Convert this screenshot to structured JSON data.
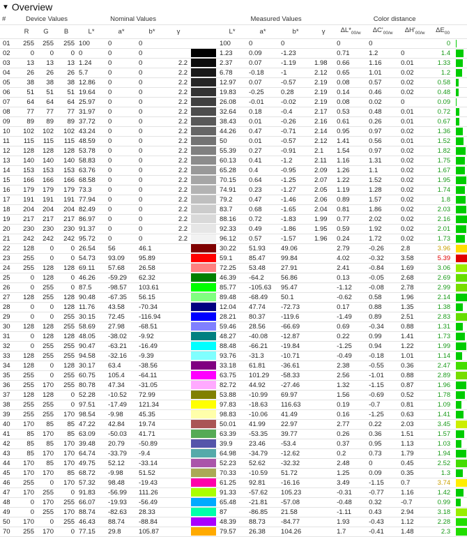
{
  "section": {
    "title": "Overview",
    "collapse_icon": "triangle-down-icon"
  },
  "header": {
    "group_row": [
      "#",
      "Device Values",
      "Nominal Values",
      "Measured Values",
      "Color distance"
    ],
    "columns": [
      "R",
      "G",
      "B",
      "L*",
      "a*",
      "b*",
      "γ",
      "L*",
      "a*",
      "b*",
      "γ",
      "ΔL*00/w",
      "ΔC'00/w",
      "ΔH'00/w",
      "ΔE00"
    ]
  },
  "colors": {
    "good": "#1a9a1a",
    "warn": "#c9a000",
    "bad": "#e00000"
  },
  "rows": [
    {
      "n": "01",
      "r": "255",
      "g": "255",
      "b": "255",
      "nl": "100",
      "na": "0",
      "nb": "0",
      "ng": "",
      "ml": "100",
      "ma": "0",
      "mb": "0",
      "mg": "",
      "dl": "0",
      "dc": "0",
      "dh": "",
      "de": "0",
      "sw": "#ffffff",
      "barc": "#00cc00"
    },
    {
      "n": "02",
      "r": "0",
      "g": "0",
      "b": "0",
      "nl": "0",
      "na": "0",
      "nb": "0",
      "ng": "",
      "ml": "1.23",
      "ma": "0.09",
      "mb": "-1.23",
      "mg": "",
      "dl": "0.71",
      "dc": "1.2",
      "dh": "0",
      "de": "1.4",
      "sw": "#000000",
      "barc": "#00cc00"
    },
    {
      "n": "03",
      "r": "13",
      "g": "13",
      "b": "13",
      "nl": "1.24",
      "na": "0",
      "nb": "0",
      "ng": "2.2",
      "ml": "2.37",
      "ma": "0.07",
      "mb": "-1.19",
      "mg": "1.98",
      "dl": "0.66",
      "dc": "1.16",
      "dh": "0.01",
      "de": "1.33",
      "sw": "#0d0d0d",
      "barc": "#00cc00"
    },
    {
      "n": "04",
      "r": "26",
      "g": "26",
      "b": "26",
      "nl": "5.7",
      "na": "0",
      "nb": "0",
      "ng": "2.2",
      "ml": "6.78",
      "ma": "-0.18",
      "mb": "-1",
      "mg": "2.12",
      "dl": "0.65",
      "dc": "1.01",
      "dh": "0.02",
      "de": "1.2",
      "sw": "#1a1a1a",
      "barc": "#00cc00"
    },
    {
      "n": "05",
      "r": "38",
      "g": "38",
      "b": "38",
      "nl": "12.86",
      "na": "0",
      "nb": "0",
      "ng": "2.2",
      "ml": "12.97",
      "ma": "0.07",
      "mb": "-0.57",
      "mg": "2.19",
      "dl": "0.08",
      "dc": "0.57",
      "dh": "0.02",
      "de": "0.58",
      "sw": "#262626",
      "barc": "#00cc00"
    },
    {
      "n": "06",
      "r": "51",
      "g": "51",
      "b": "51",
      "nl": "19.64",
      "na": "0",
      "nb": "0",
      "ng": "2.2",
      "ml": "19.83",
      "ma": "-0.25",
      "mb": "0.28",
      "mg": "2.19",
      "dl": "0.14",
      "dc": "0.46",
      "dh": "0.02",
      "de": "0.48",
      "sw": "#333333",
      "barc": "#00cc00"
    },
    {
      "n": "07",
      "r": "64",
      "g": "64",
      "b": "64",
      "nl": "25.97",
      "na": "0",
      "nb": "0",
      "ng": "2.2",
      "ml": "26.08",
      "ma": "-0.01",
      "mb": "-0.02",
      "mg": "2.19",
      "dl": "0.08",
      "dc": "0.02",
      "dh": "0",
      "de": "0.09",
      "sw": "#404040",
      "barc": "#00cc00"
    },
    {
      "n": "08",
      "r": "77",
      "g": "77",
      "b": "77",
      "nl": "31.97",
      "na": "0",
      "nb": "0",
      "ng": "2.2",
      "ml": "32.64",
      "ma": "0.18",
      "mb": "-0.4",
      "mg": "2.17",
      "dl": "0.53",
      "dc": "0.48",
      "dh": "0.01",
      "de": "0.72",
      "sw": "#4d4d4d",
      "barc": "#00cc00"
    },
    {
      "n": "09",
      "r": "89",
      "g": "89",
      "b": "89",
      "nl": "37.72",
      "na": "0",
      "nb": "0",
      "ng": "2.2",
      "ml": "38.43",
      "ma": "0.01",
      "mb": "-0.26",
      "mg": "2.16",
      "dl": "0.61",
      "dc": "0.26",
      "dh": "0.01",
      "de": "0.67",
      "sw": "#595959",
      "barc": "#00cc00"
    },
    {
      "n": "10",
      "r": "102",
      "g": "102",
      "b": "102",
      "nl": "43.24",
      "na": "0",
      "nb": "0",
      "ng": "2.2",
      "ml": "44.26",
      "ma": "0.47",
      "mb": "-0.71",
      "mg": "2.14",
      "dl": "0.95",
      "dc": "0.97",
      "dh": "0.02",
      "de": "1.36",
      "sw": "#666666",
      "barc": "#00cc00"
    },
    {
      "n": "11",
      "r": "115",
      "g": "115",
      "b": "115",
      "nl": "48.59",
      "na": "0",
      "nb": "0",
      "ng": "2.2",
      "ml": "50",
      "ma": "0.01",
      "mb": "-0.57",
      "mg": "2.12",
      "dl": "1.41",
      "dc": "0.56",
      "dh": "0.01",
      "de": "1.52",
      "sw": "#737373",
      "barc": "#00cc00"
    },
    {
      "n": "12",
      "r": "128",
      "g": "128",
      "b": "128",
      "nl": "53.78",
      "na": "0",
      "nb": "0",
      "ng": "2.2",
      "ml": "55.39",
      "ma": "0.27",
      "mb": "-0.91",
      "mg": "2.1",
      "dl": "1.54",
      "dc": "0.97",
      "dh": "0.02",
      "de": "1.82",
      "sw": "#808080",
      "barc": "#00cc00"
    },
    {
      "n": "13",
      "r": "140",
      "g": "140",
      "b": "140",
      "nl": "58.83",
      "na": "0",
      "nb": "0",
      "ng": "2.2",
      "ml": "60.13",
      "ma": "0.41",
      "mb": "-1.2",
      "mg": "2.11",
      "dl": "1.16",
      "dc": "1.31",
      "dh": "0.02",
      "de": "1.75",
      "sw": "#8c8c8c",
      "barc": "#00cc00"
    },
    {
      "n": "14",
      "r": "153",
      "g": "153",
      "b": "153",
      "nl": "63.76",
      "na": "0",
      "nb": "0",
      "ng": "2.2",
      "ml": "65.28",
      "ma": "0.4",
      "mb": "-0.95",
      "mg": "2.09",
      "dl": "1.26",
      "dc": "1.1",
      "dh": "0.02",
      "de": "1.67",
      "sw": "#999999",
      "barc": "#00cc00"
    },
    {
      "n": "15",
      "r": "166",
      "g": "166",
      "b": "166",
      "nl": "68.58",
      "na": "0",
      "nb": "0",
      "ng": "2.2",
      "ml": "70.15",
      "ma": "0.64",
      "mb": "-1.25",
      "mg": "2.07",
      "dl": "1.22",
      "dc": "1.52",
      "dh": "0.02",
      "de": "1.95",
      "sw": "#a6a6a6",
      "barc": "#00cc00"
    },
    {
      "n": "16",
      "r": "179",
      "g": "179",
      "b": "179",
      "nl": "73.3",
      "na": "0",
      "nb": "0",
      "ng": "2.2",
      "ml": "74.91",
      "ma": "0.23",
      "mb": "-1.27",
      "mg": "2.05",
      "dl": "1.19",
      "dc": "1.28",
      "dh": "0.02",
      "de": "1.74",
      "sw": "#b3b3b3",
      "barc": "#00cc00"
    },
    {
      "n": "17",
      "r": "191",
      "g": "191",
      "b": "191",
      "nl": "77.94",
      "na": "0",
      "nb": "0",
      "ng": "2.2",
      "ml": "79.2",
      "ma": "0.47",
      "mb": "-1.46",
      "mg": "2.06",
      "dl": "0.89",
      "dc": "1.57",
      "dh": "0.02",
      "de": "1.8",
      "sw": "#bfbfbf",
      "barc": "#00cc00"
    },
    {
      "n": "18",
      "r": "204",
      "g": "204",
      "b": "204",
      "nl": "82.49",
      "na": "0",
      "nb": "0",
      "ng": "2.2",
      "ml": "83.7",
      "ma": "0.68",
      "mb": "-1.65",
      "mg": "2.04",
      "dl": "0.81",
      "dc": "1.86",
      "dh": "0.02",
      "de": "2.03",
      "sw": "#cccccc",
      "barc": "#00cc00"
    },
    {
      "n": "19",
      "r": "217",
      "g": "217",
      "b": "217",
      "nl": "86.97",
      "na": "0",
      "nb": "0",
      "ng": "2.2",
      "ml": "88.16",
      "ma": "0.72",
      "mb": "-1.83",
      "mg": "1.99",
      "dl": "0.77",
      "dc": "2.02",
      "dh": "0.02",
      "de": "2.16",
      "sw": "#d9d9d9",
      "barc": "#00cc00"
    },
    {
      "n": "20",
      "r": "230",
      "g": "230",
      "b": "230",
      "nl": "91.37",
      "na": "0",
      "nb": "0",
      "ng": "2.2",
      "ml": "92.33",
      "ma": "0.49",
      "mb": "-1.86",
      "mg": "1.95",
      "dl": "0.59",
      "dc": "1.92",
      "dh": "0.02",
      "de": "2.01",
      "sw": "#e6e6e6",
      "barc": "#00cc00"
    },
    {
      "n": "21",
      "r": "242",
      "g": "242",
      "b": "242",
      "nl": "95.72",
      "na": "0",
      "nb": "0",
      "ng": "2.2",
      "ml": "96.12",
      "ma": "0.57",
      "mb": "-1.57",
      "mg": "1.96",
      "dl": "0.24",
      "dc": "1.72",
      "dh": "0.02",
      "de": "1.73",
      "sw": "#f2f2f2",
      "barc": "#00cc00"
    },
    {
      "n": "22",
      "r": "128",
      "g": "0",
      "b": "0",
      "nl": "26.54",
      "na": "56",
      "nb": "46.1",
      "ng": "",
      "ml": "30.22",
      "ma": "51.93",
      "mb": "49.06",
      "mg": "",
      "dl": "2.79",
      "dc": "-0.26",
      "dh": "2.8",
      "de": "3.96",
      "sw": "#800000",
      "barc": "#ffdd00"
    },
    {
      "n": "23",
      "r": "255",
      "g": "0",
      "b": "0",
      "nl": "54.73",
      "na": "93.09",
      "nb": "95.89",
      "ng": "",
      "ml": "59.1",
      "ma": "85.47",
      "mb": "99.84",
      "mg": "",
      "dl": "4.02",
      "dc": "-0.32",
      "dh": "3.58",
      "de": "5.39",
      "sw": "#ff0000",
      "barc": "#e00000"
    },
    {
      "n": "24",
      "r": "255",
      "g": "128",
      "b": "128",
      "nl": "69.11",
      "na": "57.68",
      "nb": "26.58",
      "ng": "",
      "ml": "72.25",
      "ma": "53.48",
      "mb": "27.91",
      "mg": "",
      "dl": "2.41",
      "dc": "-0.84",
      "dh": "1.69",
      "de": "3.06",
      "sw": "#ff8080",
      "barc": "#99ee00"
    },
    {
      "n": "25",
      "r": "0",
      "g": "128",
      "b": "0",
      "nl": "46.26",
      "na": "-59.29",
      "nb": "62.32",
      "ng": "",
      "ml": "46.39",
      "ma": "-64.2",
      "mb": "56.86",
      "mg": "",
      "dl": "0.13",
      "dc": "-0.05",
      "dh": "2.68",
      "de": "2.69",
      "sw": "#008000",
      "barc": "#66dd00"
    },
    {
      "n": "26",
      "r": "0",
      "g": "255",
      "b": "0",
      "nl": "87.5",
      "na": "-98.57",
      "nb": "103.61",
      "ng": "",
      "ml": "85.77",
      "ma": "-105.63",
      "mb": "95.47",
      "mg": "",
      "dl": "-1.12",
      "dc": "-0.08",
      "dh": "2.78",
      "de": "2.99",
      "sw": "#00ff00",
      "barc": "#77dd00"
    },
    {
      "n": "27",
      "r": "128",
      "g": "255",
      "b": "128",
      "nl": "90.48",
      "na": "-67.35",
      "nb": "56.15",
      "ng": "",
      "ml": "89.48",
      "ma": "-68.49",
      "mb": "50.1",
      "mg": "",
      "dl": "-0.62",
      "dc": "0.58",
      "dh": "1.96",
      "de": "2.14",
      "sw": "#80ff80",
      "barc": "#00cc00"
    },
    {
      "n": "28",
      "r": "0",
      "g": "0",
      "b": "128",
      "nl": "11.76",
      "na": "43.58",
      "nb": "-70.34",
      "ng": "",
      "ml": "12.04",
      "ma": "47.74",
      "mb": "-72.73",
      "mg": "",
      "dl": "0.17",
      "dc": "0.88",
      "dh": "1.35",
      "de": "1.38",
      "sw": "#000080",
      "barc": "#00cc00"
    },
    {
      "n": "29",
      "r": "0",
      "g": "0",
      "b": "255",
      "nl": "30.15",
      "na": "72.45",
      "nb": "-116.94",
      "ng": "",
      "ml": "28.21",
      "ma": "80.37",
      "mb": "-119.6",
      "mg": "",
      "dl": "-1.49",
      "dc": "0.89",
      "dh": "2.51",
      "de": "2.83",
      "sw": "#0000ff",
      "barc": "#66dd00"
    },
    {
      "n": "30",
      "r": "128",
      "g": "128",
      "b": "255",
      "nl": "58.69",
      "na": "27.98",
      "nb": "-68.51",
      "ng": "",
      "ml": "59.46",
      "ma": "28.56",
      "mb": "-66.69",
      "mg": "",
      "dl": "0.69",
      "dc": "-0.34",
      "dh": "0.88",
      "de": "1.31",
      "sw": "#8080ff",
      "barc": "#00cc00"
    },
    {
      "n": "31",
      "r": "0",
      "g": "128",
      "b": "128",
      "nl": "48.05",
      "na": "-38.02",
      "nb": "-9.92",
      "ng": "",
      "ml": "48.27",
      "ma": "-40.08",
      "mb": "-12.87",
      "mg": "",
      "dl": "0.22",
      "dc": "0.99",
      "dh": "1.41",
      "de": "1.73",
      "sw": "#008080",
      "barc": "#00cc00"
    },
    {
      "n": "32",
      "r": "0",
      "g": "255",
      "b": "255",
      "nl": "90.47",
      "na": "-63.21",
      "nb": "-16.49",
      "ng": "",
      "ml": "88.48",
      "ma": "-66.21",
      "mb": "-19.84",
      "mg": "",
      "dl": "-1.25",
      "dc": "0.94",
      "dh": "1.22",
      "de": "1.99",
      "sw": "#00ffff",
      "barc": "#00cc00"
    },
    {
      "n": "33",
      "r": "128",
      "g": "255",
      "b": "255",
      "nl": "94.58",
      "na": "-32.16",
      "nb": "-9.39",
      "ng": "",
      "ml": "93.76",
      "ma": "-31.3",
      "mb": "-10.71",
      "mg": "",
      "dl": "-0.49",
      "dc": "-0.18",
      "dh": "1.01",
      "de": "1.14",
      "sw": "#80ffff",
      "barc": "#00cc00"
    },
    {
      "n": "34",
      "r": "128",
      "g": "0",
      "b": "128",
      "nl": "30.17",
      "na": "63.4",
      "nb": "-38.56",
      "ng": "",
      "ml": "33.18",
      "ma": "61.81",
      "mb": "-36.61",
      "mg": "",
      "dl": "2.38",
      "dc": "-0.55",
      "dh": "0.36",
      "de": "2.47",
      "sw": "#800080",
      "barc": "#44dd00"
    },
    {
      "n": "35",
      "r": "255",
      "g": "0",
      "b": "255",
      "nl": "60.75",
      "na": "105.4",
      "nb": "-64.11",
      "ng": "",
      "ml": "63.75",
      "ma": "101.29",
      "mb": "-58.33",
      "mg": "",
      "dl": "2.56",
      "dc": "-1.01",
      "dh": "0.88",
      "de": "2.89",
      "sw": "#ff00ff",
      "barc": "#77dd00"
    },
    {
      "n": "36",
      "r": "255",
      "g": "170",
      "b": "255",
      "nl": "80.78",
      "na": "47.34",
      "nb": "-31.05",
      "ng": "",
      "ml": "82.72",
      "ma": "44.92",
      "mb": "-27.46",
      "mg": "",
      "dl": "1.32",
      "dc": "-1.15",
      "dh": "0.87",
      "de": "1.96",
      "sw": "#ffaaff",
      "barc": "#00cc00"
    },
    {
      "n": "37",
      "r": "128",
      "g": "128",
      "b": "0",
      "nl": "52.28",
      "na": "-10.52",
      "nb": "72.99",
      "ng": "",
      "ml": "53.88",
      "ma": "-10.99",
      "mb": "69.97",
      "mg": "",
      "dl": "1.56",
      "dc": "-0.69",
      "dh": "0.52",
      "de": "1.78",
      "sw": "#808000",
      "barc": "#00cc00"
    },
    {
      "n": "38",
      "r": "255",
      "g": "255",
      "b": "0",
      "nl": "97.51",
      "na": "-17.49",
      "nb": "121.34",
      "ng": "",
      "ml": "97.83",
      "ma": "-18.63",
      "mb": "116.63",
      "mg": "",
      "dl": "0.19",
      "dc": "-0.7",
      "dh": "0.81",
      "de": "1.09",
      "sw": "#ffff00",
      "barc": "#00cc00"
    },
    {
      "n": "39",
      "r": "255",
      "g": "255",
      "b": "170",
      "nl": "98.54",
      "na": "-9.98",
      "nb": "45.35",
      "ng": "",
      "ml": "98.83",
      "ma": "-10.06",
      "mb": "41.49",
      "mg": "",
      "dl": "0.16",
      "dc": "-1.25",
      "dh": "0.63",
      "de": "1.41",
      "sw": "#ffffaa",
      "barc": "#00cc00"
    },
    {
      "n": "40",
      "r": "170",
      "g": "85",
      "b": "85",
      "nl": "47.22",
      "na": "42.84",
      "nb": "19.74",
      "ng": "",
      "ml": "50.01",
      "ma": "41.99",
      "mb": "22.97",
      "mg": "",
      "dl": "2.77",
      "dc": "0.22",
      "dh": "2.03",
      "de": "3.45",
      "sw": "#aa5555",
      "barc": "#ccee00"
    },
    {
      "n": "41",
      "r": "85",
      "g": "170",
      "b": "85",
      "nl": "63.09",
      "na": "-50.03",
      "nb": "41.71",
      "ng": "",
      "ml": "63.39",
      "ma": "-53.35",
      "mb": "39.77",
      "mg": "",
      "dl": "0.26",
      "dc": "0.36",
      "dh": "1.51",
      "de": "1.57",
      "sw": "#55aa55",
      "barc": "#00cc00"
    },
    {
      "n": "42",
      "r": "85",
      "g": "85",
      "b": "170",
      "nl": "39.48",
      "na": "20.79",
      "nb": "-50.89",
      "ng": "",
      "ml": "39.9",
      "ma": "23.46",
      "mb": "-53.4",
      "mg": "",
      "dl": "0.37",
      "dc": "0.95",
      "dh": "1.13",
      "de": "1.03",
      "sw": "#5555aa",
      "barc": "#00cc00"
    },
    {
      "n": "43",
      "r": "85",
      "g": "170",
      "b": "170",
      "nl": "64.74",
      "na": "-33.79",
      "nb": "-9.4",
      "ng": "",
      "ml": "64.98",
      "ma": "-34.79",
      "mb": "-12.62",
      "mg": "",
      "dl": "0.2",
      "dc": "0.73",
      "dh": "1.79",
      "de": "1.94",
      "sw": "#55aaaa",
      "barc": "#00cc00"
    },
    {
      "n": "44",
      "r": "170",
      "g": "85",
      "b": "170",
      "nl": "49.75",
      "na": "52.12",
      "nb": "-33.14",
      "ng": "",
      "ml": "52.23",
      "ma": "52.62",
      "mb": "-32.32",
      "mg": "",
      "dl": "2.48",
      "dc": "0",
      "dh": "0.45",
      "de": "2.52",
      "sw": "#aa55aa",
      "barc": "#44dd00"
    },
    {
      "n": "45",
      "r": "170",
      "g": "170",
      "b": "85",
      "nl": "68.72",
      "na": "-9.98",
      "nb": "51.52",
      "ng": "",
      "ml": "70.33",
      "ma": "-10.59",
      "mb": "51.72",
      "mg": "",
      "dl": "1.25",
      "dc": "0.09",
      "dh": "0.35",
      "de": "1.3",
      "sw": "#aaaa55",
      "barc": "#00cc00"
    },
    {
      "n": "46",
      "r": "255",
      "g": "0",
      "b": "170",
      "nl": "57.32",
      "na": "98.48",
      "nb": "-19.43",
      "ng": "",
      "ml": "61.25",
      "ma": "92.81",
      "mb": "-16.16",
      "mg": "",
      "dl": "3.49",
      "dc": "-1.15",
      "dh": "0.7",
      "de": "3.74",
      "sw": "#ff00aa",
      "barc": "#ffee00"
    },
    {
      "n": "47",
      "r": "170",
      "g": "255",
      "b": "0",
      "nl": "91.83",
      "na": "-56.99",
      "nb": "111.26",
      "ng": "",
      "ml": "91.33",
      "ma": "-57.62",
      "mb": "105.23",
      "mg": "",
      "dl": "-0.31",
      "dc": "-0.77",
      "dh": "1.16",
      "de": "1.42",
      "sw": "#aaff00",
      "barc": "#00cc00"
    },
    {
      "n": "48",
      "r": "0",
      "g": "170",
      "b": "255",
      "nl": "66.07",
      "na": "-19.93",
      "nb": "-56.49",
      "ng": "",
      "ml": "65.48",
      "ma": "-21.81",
      "mb": "-57.08",
      "mg": "",
      "dl": "-0.48",
      "dc": "0.32",
      "dh": "-0.7",
      "de": "0.99",
      "sw": "#00aaff",
      "barc": "#00cc00"
    },
    {
      "n": "49",
      "r": "0",
      "g": "255",
      "b": "170",
      "nl": "88.74",
      "na": "-82.63",
      "nb": "28.33",
      "ng": "",
      "ml": "87",
      "ma": "-86.85",
      "mb": "21.58",
      "mg": "",
      "dl": "-1.11",
      "dc": "0.43",
      "dh": "2.94",
      "de": "3.18",
      "sw": "#00ffaa",
      "barc": "#99ee00"
    },
    {
      "n": "50",
      "r": "170",
      "g": "0",
      "b": "255",
      "nl": "46.43",
      "na": "88.74",
      "nb": "-88.84",
      "ng": "",
      "ml": "48.39",
      "ma": "88.73",
      "mb": "-84.77",
      "mg": "",
      "dl": "1.93",
      "dc": "-0.43",
      "dh": "1.12",
      "de": "2.28",
      "sw": "#aa00ff",
      "barc": "#22dd00"
    },
    {
      "n": "70",
      "r": "255",
      "g": "170",
      "b": "0",
      "nl": "77.15",
      "na": "29.8",
      "nb": "105.87",
      "ng": "",
      "ml": "79.57",
      "ma": "26.38",
      "mb": "104.26",
      "mg": "",
      "dl": "1.7",
      "dc": "-0.41",
      "dh": "1.48",
      "de": "2.3",
      "sw": "#ffaa00",
      "barc": "#22dd00"
    }
  ]
}
